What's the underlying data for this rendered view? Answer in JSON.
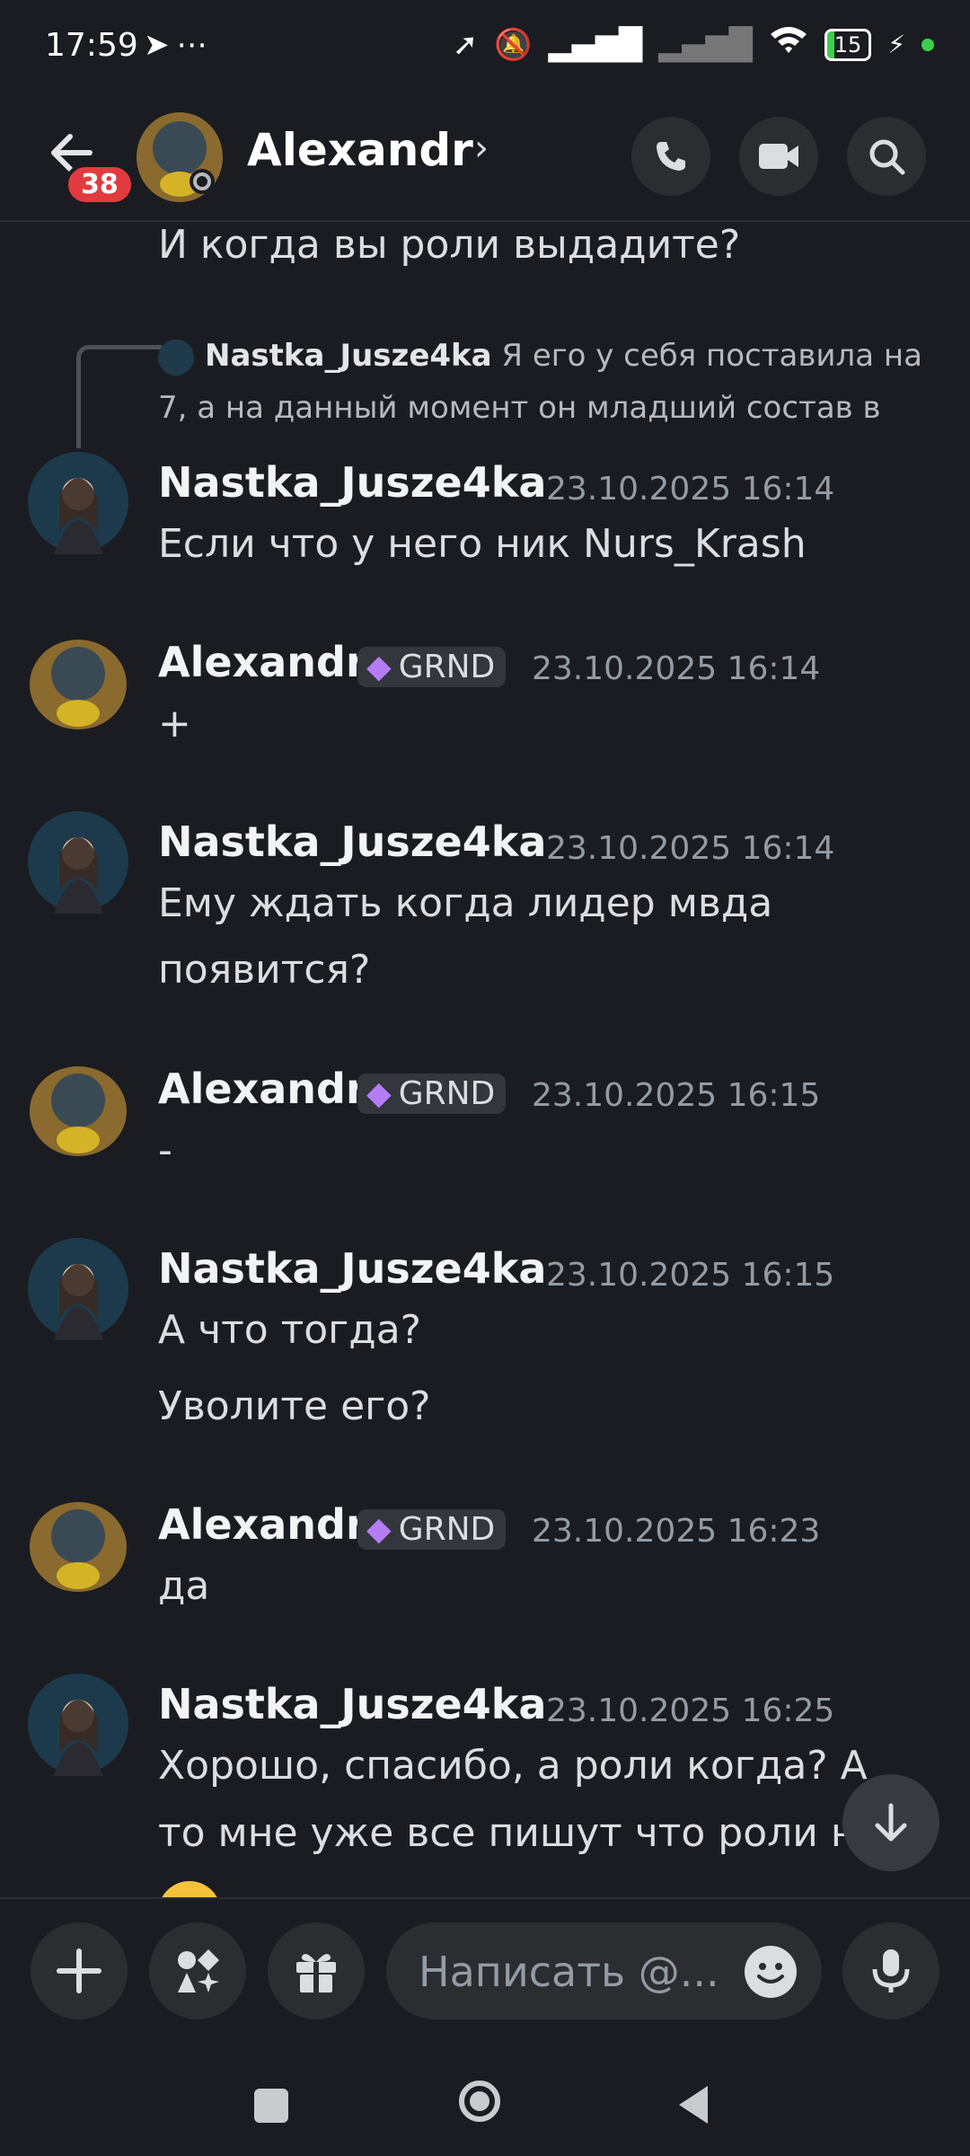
{
  "status_bar": {
    "time": "17:59",
    "battery": "15"
  },
  "header": {
    "name": "Alexandr",
    "unread_count": "38"
  },
  "chat": {
    "top_message": "И когда вы роли выдадите?",
    "reply": {
      "author": "Nastka_Jusze4ka",
      "text": "Я его у себя поставила на 7, а на данный момент он младший состав в"
    },
    "groups": [
      {
        "author": "Nastka_Jusze4ka",
        "tag": "",
        "time": "23.10.2025 16:14",
        "lines": [
          "Если что у него ник Nurs_Krash"
        ]
      },
      {
        "author": "Alexandr",
        "tag": "GRND",
        "time": "23.10.2025 16:14",
        "lines": [
          "+"
        ]
      },
      {
        "author": "Nastka_Jusze4ka",
        "tag": "",
        "time": "23.10.2025 16:14",
        "lines": [
          "Ему ждать когда лидер мвда",
          "появится?"
        ]
      },
      {
        "author": "Alexandr",
        "tag": "GRND",
        "time": "23.10.2025 16:15",
        "lines": [
          "-"
        ]
      },
      {
        "author": "Nastka_Jusze4ka",
        "tag": "",
        "time": "23.10.2025 16:15",
        "lines": [
          "А что тогда?",
          "Уволите его?"
        ]
      },
      {
        "author": "Alexandr",
        "tag": "GRND",
        "time": "23.10.2025 16:23",
        "lines": [
          "да"
        ]
      },
      {
        "author": "Nastka_Jusze4ka",
        "tag": "",
        "time": "23.10.2025 16:25",
        "lines": [
          "Хорошо, спасибо, а роли когда? А",
          "то мне уже все пишут что роли не"
        ]
      }
    ]
  },
  "composer": {
    "placeholder": "Написать @..."
  },
  "icons": {
    "back": "back-arrow-icon",
    "call": "phone-icon",
    "video": "video-icon",
    "search": "search-icon",
    "plus": "plus-icon",
    "apps": "apps-icon",
    "gift": "gift-icon",
    "emoji": "emoji-icon",
    "mic": "mic-icon",
    "scroll_down": "arrow-down-icon",
    "gem": "gem-icon"
  },
  "colors": {
    "background": "#1b1c21",
    "badge": "#e13b3f",
    "accent_green": "#3ccf4e",
    "gem": "#b57cf5"
  }
}
